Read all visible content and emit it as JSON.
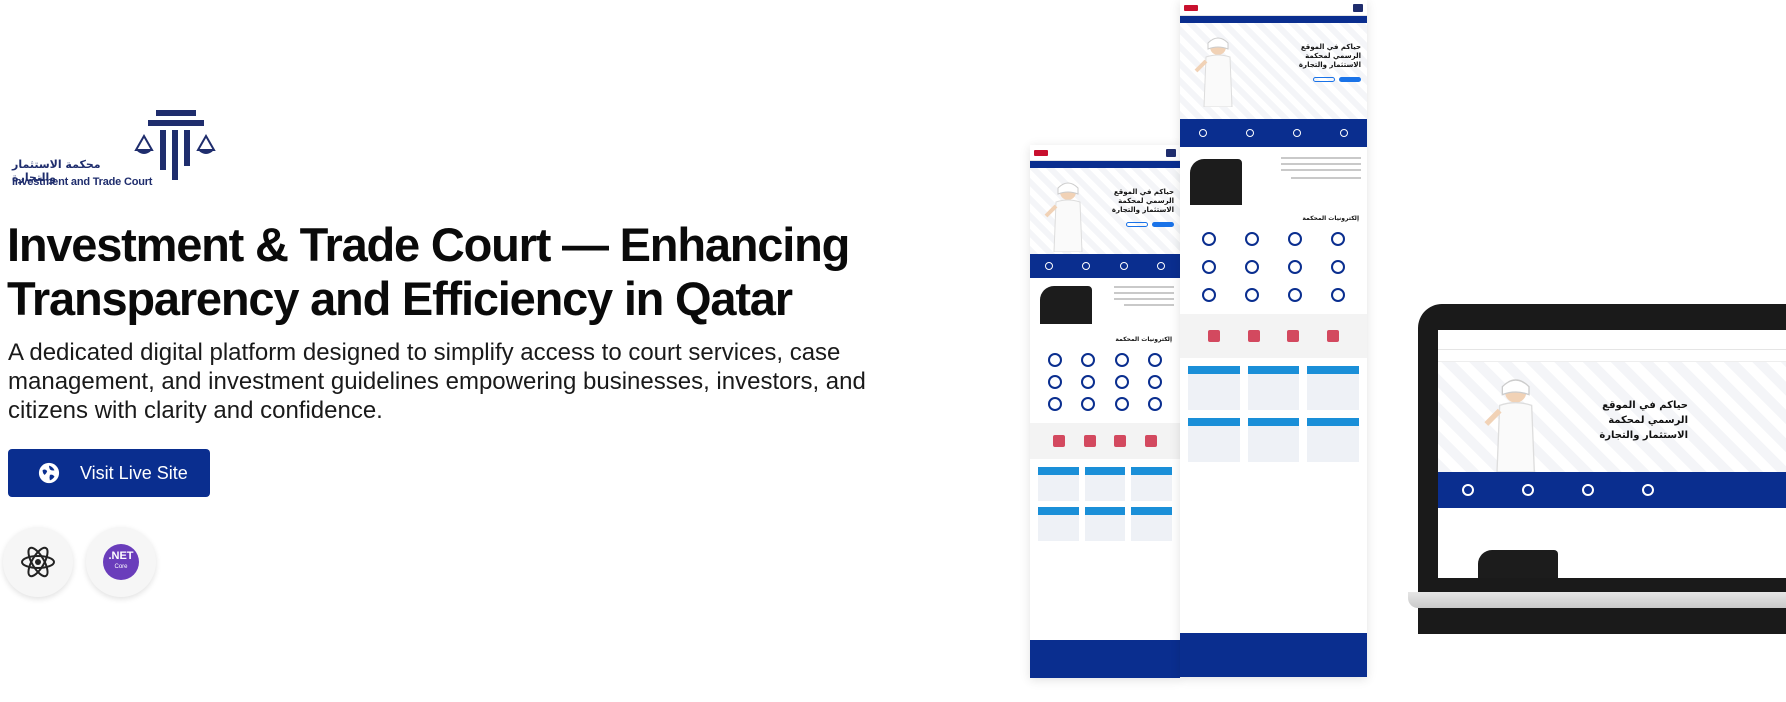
{
  "brand": {
    "logo_arabic": "محكمة الاستثمار والتجارة",
    "logo_english": "Investment and Trade Court",
    "primary_color": "#0a2e8f",
    "accent_color": "#c8102e"
  },
  "hero": {
    "headline": "Investment & Trade Court — Enhancing Transparency and Efficiency in Qatar",
    "description": "A dedicated digital platform designed to simplify access to court services, case management, and investment guidelines empowering businesses, investors, and citizens with clarity and confidence.",
    "cta_label": "Visit Live Site",
    "cta_icon": "globe-icon"
  },
  "tech_stack": [
    {
      "name": "react-icon"
    },
    {
      "name": "dotnet-core-icon",
      "label": ".NET",
      "sublabel": "Core"
    }
  ],
  "mockup": {
    "hero_title": "حياكم في الموقع الرسمي لمحكمة الاستثمار والتجارة",
    "services_title": "إلكترونيات المحكمة"
  }
}
